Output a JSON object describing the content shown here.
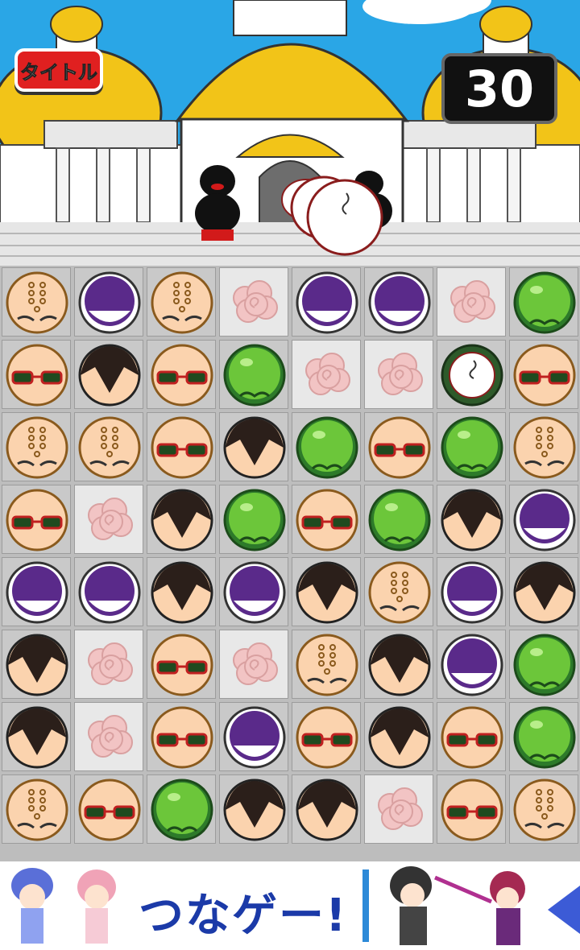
{
  "header": {
    "title_button_label": "タイトル",
    "timer_value": "30"
  },
  "colors": {
    "sky": "#2aa6e6",
    "dome": "#f2c418",
    "timer_bg": "#111111",
    "title_button_bg": "#e02020",
    "banner_text": "#1b3aa8"
  },
  "board": {
    "rows": 8,
    "cols": 8,
    "legend": {
      "B": "bald-monk-face-icon",
      "P": "purple-orb-icon",
      "G": "green-orb-icon",
      "S": "sunglasses-face-icon",
      "H": "spiky-hair-face-icon",
      "C": "pink-cloud-icon",
      "E": "white-egg-icon"
    },
    "grid": [
      [
        "B",
        "P",
        "B",
        "C",
        "P",
        "P",
        "C",
        "G"
      ],
      [
        "S",
        "H",
        "S",
        "G",
        "C",
        "C",
        "E",
        "S"
      ],
      [
        "B",
        "B",
        "S",
        "H",
        "G",
        "S",
        "G",
        "B"
      ],
      [
        "S",
        "C",
        "H",
        "G",
        "S",
        "G",
        "H",
        "P"
      ],
      [
        "P",
        "P",
        "H",
        "P",
        "H",
        "B",
        "P",
        "H"
      ],
      [
        "H",
        "C",
        "S",
        "C",
        "B",
        "H",
        "P",
        "G"
      ],
      [
        "H",
        "C",
        "S",
        "P",
        "S",
        "H",
        "S",
        "G"
      ],
      [
        "B",
        "S",
        "G",
        "H",
        "H",
        "C",
        "S",
        "B"
      ]
    ]
  },
  "banner": {
    "text": "つなゲー!"
  }
}
